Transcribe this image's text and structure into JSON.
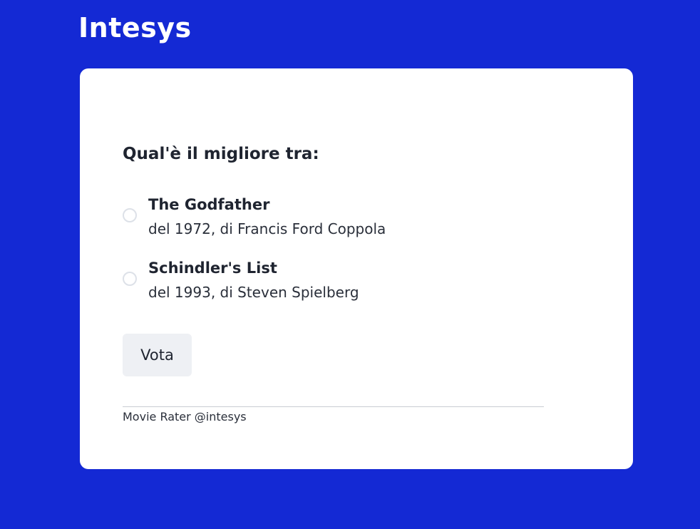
{
  "header": {
    "brand": "Intesys"
  },
  "poll": {
    "question": "Qual'è il migliore tra:",
    "options": [
      {
        "title": "The Godfather",
        "subtitle": "del 1972, di Francis Ford Coppola",
        "selected": false
      },
      {
        "title": "Schindler's List",
        "subtitle": "del 1993, di Steven Spielberg",
        "selected": false
      }
    ],
    "vote_label": "Vota"
  },
  "footer": {
    "text": "Movie Rater @intesys"
  },
  "colors": {
    "background": "#1429d4",
    "card": "#ffffff",
    "text": "#1f2430",
    "button_bg": "#eef0f4",
    "radio_border": "#dde1e8"
  }
}
